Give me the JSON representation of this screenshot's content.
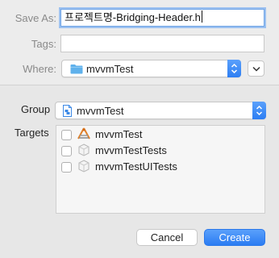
{
  "save_as": {
    "label": "Save As:",
    "value": "프로젝트명-Bridging-Header.h"
  },
  "tags": {
    "label": "Tags:",
    "value": ""
  },
  "where": {
    "label": "Where:",
    "value": "mvvmTest"
  },
  "group": {
    "label": "Group",
    "value": "mvvmTest"
  },
  "targets": {
    "label": "Targets",
    "items": [
      {
        "label": "mvvmTest",
        "icon": "app-target-icon",
        "checked": false
      },
      {
        "label": "mvvmTestTests",
        "icon": "test-target-icon",
        "checked": false
      },
      {
        "label": "mvvmTestUITests",
        "icon": "test-target-icon",
        "checked": false
      }
    ]
  },
  "buttons": {
    "cancel": "Cancel",
    "create": "Create"
  },
  "colors": {
    "accent": "#2d7ef3",
    "folder": "#5fb1ec"
  }
}
